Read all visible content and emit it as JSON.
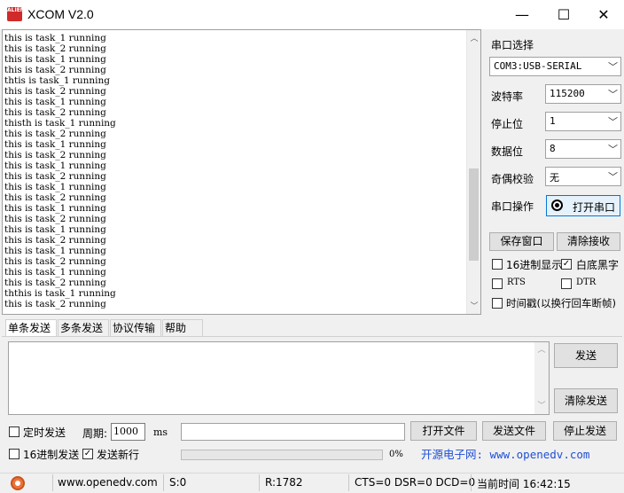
{
  "window": {
    "icon_text": "ALIENTEK",
    "title": "XCOM V2.0",
    "minimize_glyph": "—",
    "maximize_glyph": "☐",
    "close_glyph": "✕"
  },
  "receive": {
    "lines": [
      "this is task_1 running",
      "this is task_2 running",
      "this is task_1 running",
      "this is task_2 running",
      "thtis is task_1 running",
      "this is task_2 running",
      "this is task_1 running",
      "this is task_2 running",
      "thisth is task_1 running",
      "this is task_2 running",
      "this is task_1 running",
      "this is task_2 running",
      "this is task_1 running",
      "this is task_2 running",
      "this is task_1 running",
      "this is task_2 running",
      "this is task_1 running",
      "this is task_2 running",
      "this is task_1 running",
      "this is task_2 running",
      "this is task_1 running",
      "this is task_2 running",
      "this is task_1 running",
      "this is task_2 running",
      "ththis is task_1 running",
      "this is task_2 running"
    ],
    "scroll_up": "︿",
    "scroll_down": "﹀"
  },
  "serial": {
    "port_label": "串口选择",
    "port_value": "COM3:USB-SERIAL",
    "baud_label": "波特率",
    "baud_value": "115200",
    "stop_label": "停止位",
    "stop_value": "1",
    "data_label": "数据位",
    "data_value": "8",
    "parity_label": "奇偶校验",
    "parity_value": "无",
    "op_label": "串口操作",
    "open_button": "打开串口",
    "chevron": "﹀"
  },
  "actions": {
    "save_window": "保存窗口",
    "clear_receive": "清除接收",
    "hex_display": "16进制显示",
    "white_bg": "白底黑字",
    "rts": "RTS",
    "dtr": "DTR",
    "timestamp": "时间戳(以换行回车断帧)",
    "check_mark": "✓"
  },
  "tabs": [
    "单条发送",
    "多条发送",
    "协议传输",
    "帮助"
  ],
  "send": {
    "send_button": "发送",
    "clear_send_button": "清除发送",
    "timed_send": "定时发送",
    "period_label": "周期:",
    "period_value": "1000",
    "period_unit": "ms",
    "open_file": "打开文件",
    "send_file": "发送文件",
    "stop_send": "停止发送",
    "hex_send": "16进制发送",
    "send_newline": "发送新行",
    "progress_text": "0%",
    "progress": 0,
    "website_banner": "开源电子网: www.openedv.com"
  },
  "status": {
    "url": "www.openedv.com",
    "sent": "S:0",
    "received": "R:1782",
    "lines": "CTS=0 DSR=0 DCD=0",
    "time": "当前时间 16:42:15"
  },
  "colors": {
    "banner_text": "#1f4fd6",
    "icon_bg": "#d02a2a"
  }
}
